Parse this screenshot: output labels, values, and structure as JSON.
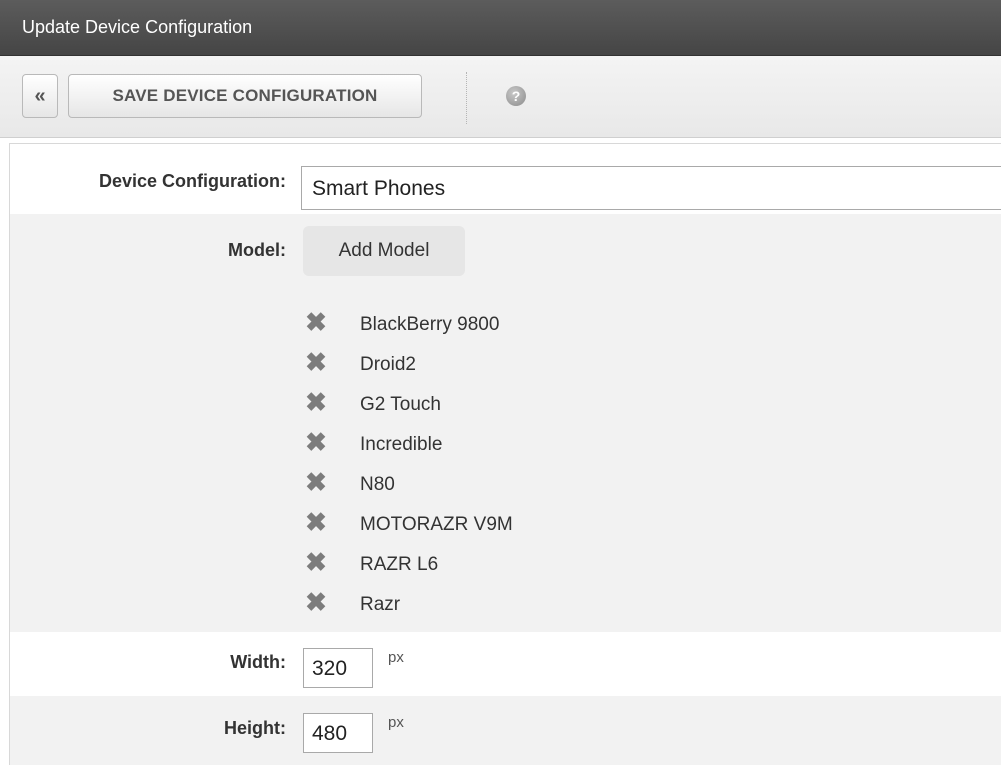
{
  "window": {
    "title": "Update Device Configuration"
  },
  "toolbar": {
    "back_icon": "chevron-left-icon",
    "back_glyph": "«",
    "save_label": "SAVE DEVICE CONFIGURATION",
    "help_icon": "help-icon",
    "help_glyph": "?"
  },
  "form": {
    "config_label": "Device Configuration:",
    "config_value": "Smart Phones",
    "model_label": "Model:",
    "add_model_label": "Add Model",
    "remove_icon": "remove-x-icon",
    "remove_glyph": "✖",
    "models": [
      "BlackBerry 9800",
      "Droid2",
      "G2 Touch",
      "Incredible",
      "N80",
      "MOTORAZR V9M",
      "RAZR L6",
      "Razr"
    ],
    "width_label": "Width:",
    "width_value": "320",
    "width_unit": "px",
    "height_label": "Height:",
    "height_value": "480",
    "height_unit": "px"
  },
  "colors": {
    "titlebar": "#4f4f4f",
    "row_alt": "#f2f2f2",
    "remove_icon": "#7c7c7c"
  }
}
